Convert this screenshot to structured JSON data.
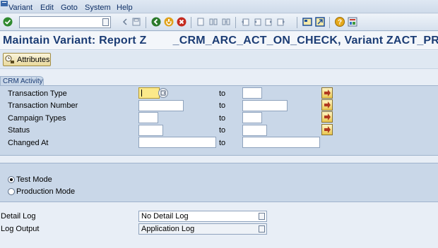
{
  "menubar": {
    "items": [
      "Variant",
      "Edit",
      "Goto",
      "System",
      "Help"
    ]
  },
  "toolbar": {
    "command_field_value": "",
    "icons": [
      "enter-icon",
      "back-arrow-icon",
      "save-icon",
      "back-icon",
      "exit-icon",
      "cancel-icon",
      "print-icon",
      "find-icon",
      "find-next-icon",
      "first-page-icon",
      "previous-page-icon",
      "next-page-icon",
      "last-page-icon",
      "create-session-icon",
      "shortcut-icon",
      "help-icon",
      "layout-icon"
    ]
  },
  "title": "Maintain Variant: Report Z        _CRM_ARC_ACT_ON_CHECK, Variant ZACT_PRE",
  "app_toolbar": {
    "attributes_label": "Attributes"
  },
  "selection_group": {
    "title": "CRM Activity",
    "to_label": "to",
    "rows": [
      {
        "label": "Transaction Type",
        "from": "",
        "to": ""
      },
      {
        "label": "Transaction Number",
        "from": "",
        "to": ""
      },
      {
        "label": "Campaign Types",
        "from": "",
        "to": ""
      },
      {
        "label": "Status",
        "from": "",
        "to": ""
      },
      {
        "label": "Changed At",
        "from": "",
        "to": ""
      }
    ]
  },
  "mode_group": {
    "options": [
      {
        "label": "Test Mode",
        "selected": true
      },
      {
        "label": "Production Mode",
        "selected": false
      }
    ]
  },
  "log_settings": {
    "detail_log_label": "Detail Log",
    "detail_log_value": "No Detail Log",
    "log_output_label": "Log Output",
    "log_output_value": "Application Log"
  },
  "colors": {
    "title_text": "#1b3c74",
    "group_background": "#c9d7e8",
    "required_field": "#fbe98a",
    "multi_button": "#e9c64f"
  }
}
